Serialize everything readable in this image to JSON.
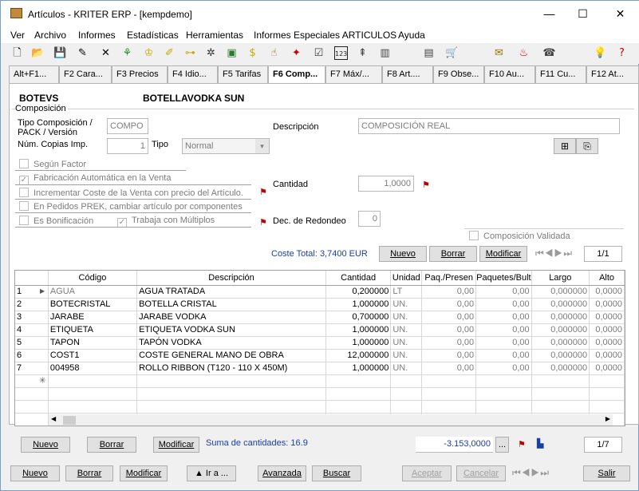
{
  "window": {
    "title": "Artículos - KRITER ERP - [kempdemo]",
    "minimize": "—",
    "maximize": "☐",
    "close": "✕"
  },
  "menu": [
    "Ver",
    "Archivo",
    "Informes",
    "Estadísticas",
    "Herramientas",
    "Informes Especiales ARTICULOS",
    "Ayuda"
  ],
  "tabs": [
    "Alt+F1...",
    "F2 Cara...",
    "F3 Precios",
    "F4 Idio...",
    "F5 Tarifas",
    "F6 Comp...",
    "F7 Máx/...",
    "F8 Art....",
    "F9 Obse...",
    "F10 Au...",
    "F11 Cu...",
    "F12 At..."
  ],
  "active_tab": "F6 Comp...",
  "header": {
    "code": "BOTEVS",
    "name": "BOTELLAVODKA SUN",
    "group": "Composición"
  },
  "form": {
    "tipo_label": "Tipo Composición / PACK / Versión",
    "tipo_value": "COMPO",
    "descripcion_label": "Descripción",
    "descripcion_value": "COMPOSICIÓN REAL",
    "copias_label": "Núm. Copias Imp.",
    "copias_value": "1",
    "tipo2_label": "Tipo",
    "tipo2_value": "Normal",
    "checks": {
      "segun_factor": "Según Factor",
      "fabricacion": "Fabricación Automática en la Venta",
      "incrementar": "Incrementar Coste de la Venta con precio del Artículo.",
      "pedidos": "En Pedidos PREK, cambiar artículo por componentes",
      "bonificacion": "Es Bonificación",
      "multiplos": "Trabaja con Múltiplos",
      "validada": "Composición Validada"
    },
    "cantidad_label": "Cantidad",
    "cantidad_value": "1,0000",
    "redondeo_label": "Dec. de Redondeo",
    "redondeo_value": "0",
    "coste_total": "Coste Total: 3,7400 EUR",
    "nuevo": "Nuevo",
    "borrar": "Borrar",
    "modificar": "Modificar",
    "nav_pos": "1/1"
  },
  "grid": {
    "columns": [
      "Código",
      "Descripción",
      "Cantidad",
      "Unidad",
      "Paq./Presen",
      "Paquetes/Bult",
      "Largo",
      "Alto"
    ],
    "rows": [
      [
        "1",
        "AGUA",
        "AGUA TRATADA",
        "0,200000",
        "LT",
        "0,00",
        "0,00",
        "0,000000",
        "0,0000"
      ],
      [
        "2",
        "BOTECRISTAL",
        "BOTELLA CRISTAL",
        "1,000000",
        "UN.",
        "0,00",
        "0,00",
        "0,000000",
        "0,0000"
      ],
      [
        "3",
        "JARABE",
        "JARABE VODKA",
        "0,700000",
        "UN.",
        "0,00",
        "0,00",
        "0,000000",
        "0,0000"
      ],
      [
        "4",
        "ETIQUETA",
        "ETIQUETA VODKA SUN",
        "1,000000",
        "UN.",
        "0,00",
        "0,00",
        "0,000000",
        "0,0000"
      ],
      [
        "5",
        "TAPON",
        "TAPÓN VODKA",
        "1,000000",
        "UN.",
        "0,00",
        "0,00",
        "0,000000",
        "0,0000"
      ],
      [
        "6",
        "COST1",
        "COSTE GENERAL MANO DE OBRA",
        "12,000000",
        "UN.",
        "0,00",
        "0,00",
        "0,000000",
        "0,0000"
      ],
      [
        "7",
        "004958",
        "ROLLO RIBBON (T120 - 110 X 450M)",
        "1,000000",
        "UN.",
        "0,00",
        "0,00",
        "0,000000",
        "0,0000"
      ]
    ],
    "new_row_marker": "✳"
  },
  "lower": {
    "nuevo": "Nuevo",
    "borrar": "Borrar",
    "modificar": "Modificar",
    "suma": "Suma de cantidades: 16.9",
    "total": "-3.153,0000",
    "ellipsis": "...",
    "nav_pos": "1/7"
  },
  "bottom": {
    "nuevo": "Nuevo",
    "borrar": "Borrar",
    "modificar": "Modificar",
    "ira": "▲ Ir a ...",
    "avanzada": "Avanzada",
    "buscar": "Buscar",
    "aceptar": "Aceptar",
    "cancelar": "Cancelar",
    "salir": "Salir"
  }
}
